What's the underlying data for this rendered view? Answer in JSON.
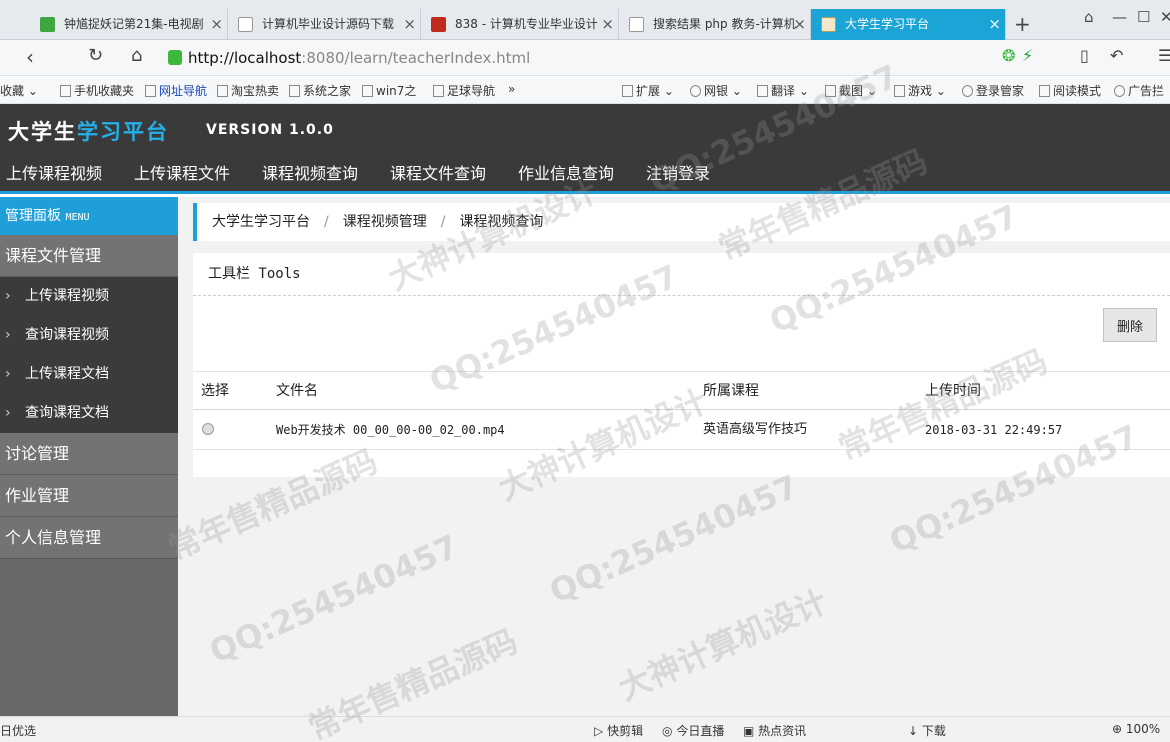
{
  "browser": {
    "tabs": [
      {
        "title": "钟馗捉妖记第21集-电视剧",
        "icon_color": "#3fa63f",
        "active": false
      },
      {
        "title": "计算机毕业设计源码下载",
        "icon_color": "#ffffff",
        "active": false
      },
      {
        "title": "838 - 计算机专业毕业设计",
        "icon_color": "#c0291e",
        "active": false
      },
      {
        "title": "搜索结果 php 教务-计算机",
        "icon_color": "#ffffff",
        "active": false
      },
      {
        "title": "大学生学习平台",
        "icon_color": "#f3e9c8",
        "active": true
      }
    ],
    "new_tab": "+",
    "url_host": "http://localhost",
    "url_rest": ":8080/learn/teacherIndex.html",
    "bookmarks": [
      "收藏",
      "手机收藏夹",
      "网址导航",
      "淘宝热卖",
      "系统之家",
      "win7之",
      "足球导航",
      "»",
      "扩展",
      "网银",
      "翻译",
      "截图",
      "游戏",
      "登录管家",
      "阅读模式",
      "广告拦"
    ],
    "status": [
      "日优选",
      "快剪辑",
      "今日直播",
      "热点资讯",
      "下载",
      "100%"
    ]
  },
  "app": {
    "logo_part1": "大学生",
    "logo_part2": "学习平台",
    "version": "VERSION 1.0.0",
    "top_menu": [
      "上传课程视频",
      "上传课程文件",
      "课程视频查询",
      "课程文件查询",
      "作业信息查询",
      "注销登录"
    ]
  },
  "sidebar": {
    "header": "管理面板",
    "header_en": "MENU",
    "section_files": "课程文件管理",
    "items": [
      "上传课程视频",
      "查询课程视频",
      "上传课程文档",
      "查询课程文档"
    ],
    "section_discussion": "讨论管理",
    "section_homework": "作业管理",
    "section_profile": "个人信息管理"
  },
  "breadcrumb": [
    "大学生学习平台",
    "课程视频管理",
    "课程视频查询"
  ],
  "breadcrumb_sep": "/",
  "toolbar": {
    "title": "工具栏 Tools",
    "delete_label": "删除"
  },
  "table": {
    "columns": [
      "选择",
      "文件名",
      "所属课程",
      "上传时间"
    ],
    "rows": [
      {
        "file": "Web开发技术 00_00_00-00_02_00.mp4",
        "course": "英语高级写作技巧",
        "time": "2018-03-31 22:49:57"
      }
    ]
  },
  "watermarks": [
    "QQ:254540457",
    "大神计算机设计",
    "常年售精品源码"
  ]
}
